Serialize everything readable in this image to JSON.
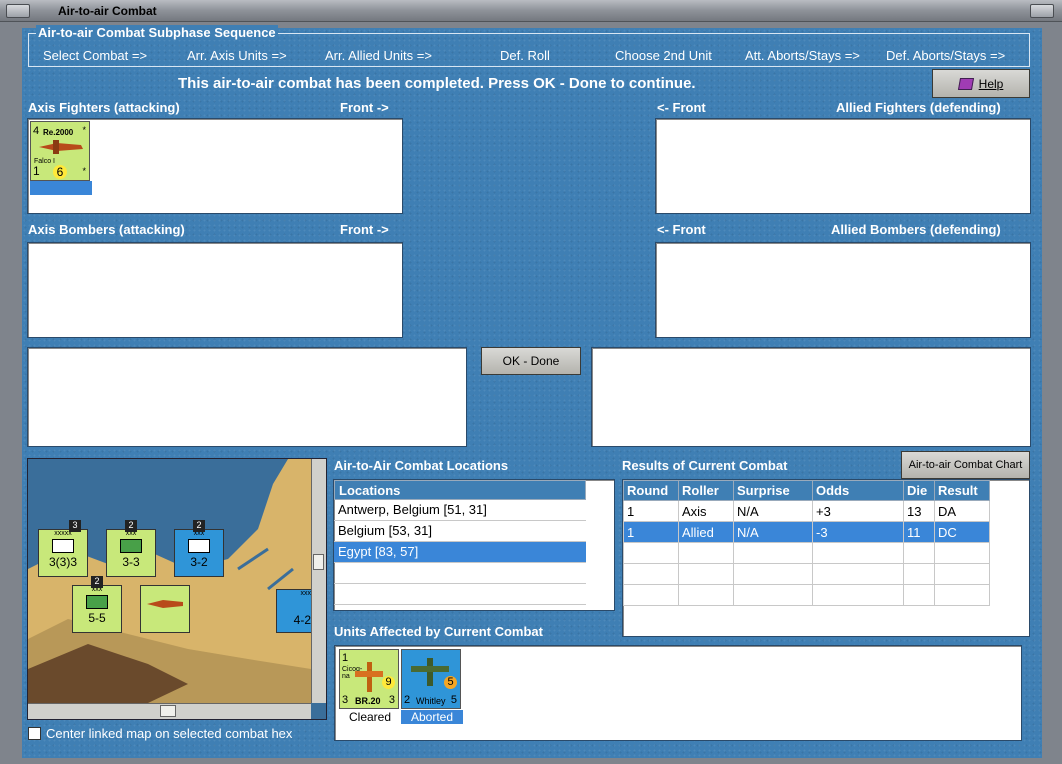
{
  "window": {
    "title": "Air-to-air Combat"
  },
  "sequence": {
    "title": "Air-to-air Combat Subphase Sequence",
    "steps": [
      "Select Combat =>",
      "Arr. Axis Units =>",
      "Arr. Allied Units =>",
      "Def. Roll",
      "Choose 2nd Unit",
      "Att. Aborts/Stays =>",
      "Def. Aborts/Stays =>"
    ]
  },
  "status_message": "This air-to-air combat has been completed.  Press OK - Done to continue.",
  "help_button": "Help",
  "panels": {
    "axis_fighters": "Axis Fighters (attacking)",
    "axis_fighters_front": "Front ->",
    "allied_fighters_front": "<- Front",
    "allied_fighters": "Allied Fighters (defending)",
    "axis_bombers": "Axis Bombers (attacking)",
    "axis_bombers_front": "Front ->",
    "allied_bombers_front": "<- Front",
    "allied_bombers": "Allied Bombers (defending)"
  },
  "axis_fighter_unit": {
    "top_left": "4",
    "name": "Re.2000",
    "top_right": "*",
    "sub": "Falco I",
    "bottom_left": "1",
    "circle": "6",
    "bottom_right": "*"
  },
  "ok_button": "OK - Done",
  "locations": {
    "title": "Air-to-Air Combat Locations",
    "header": "Locations",
    "items": [
      "Antwerp, Belgium [51, 31]",
      "Belgium [53, 31]",
      "Egypt [83, 57]"
    ],
    "selected_index": 2
  },
  "results": {
    "title": "Results of Current Combat",
    "chart_button": "Air-to-air Combat Chart",
    "columns": [
      "Round",
      "Roller",
      "Surprise",
      "Odds",
      "Die",
      "Result"
    ],
    "rows": [
      [
        "1",
        "Axis",
        "N/A",
        "+3",
        "13",
        "DA"
      ],
      [
        "1",
        "Allied",
        "N/A",
        "-3",
        "11",
        "DC"
      ]
    ],
    "selected_row": 1
  },
  "affected": {
    "title": "Units Affected by Current Combat",
    "units": [
      {
        "top_left": "1",
        "name": "Cicog-na",
        "model": "BR.20",
        "left_val": "3",
        "circle": "9",
        "right_val": "3",
        "status": "Cleared"
      },
      {
        "top_left": "2",
        "model": "Whitley",
        "circle": "5",
        "right_val": "5",
        "status": "Aborted"
      }
    ]
  },
  "map": {
    "checkbox_label": "Center linked map on selected combat hex",
    "counters": [
      {
        "size": "xxxxx",
        "value": "3(3)3",
        "badge": "3",
        "side": "Italian"
      },
      {
        "size": "xxx",
        "value": "3-3",
        "badge": "2",
        "side": "X Inf"
      },
      {
        "size": "xxx",
        "value": "3-2",
        "badge": "2",
        "side": "Allied"
      },
      {
        "size": "xxx",
        "value": "5-5",
        "badge": "2",
        "side": "Filo"
      },
      {
        "size": "xxx",
        "value": "4-2",
        "badge": "",
        "side": "Allied"
      }
    ]
  },
  "colors": {
    "background": "#3f7fb4",
    "selection": "#3a86d8",
    "counter_axis": "#c8e87a",
    "counter_allied": "#2f95d8"
  }
}
